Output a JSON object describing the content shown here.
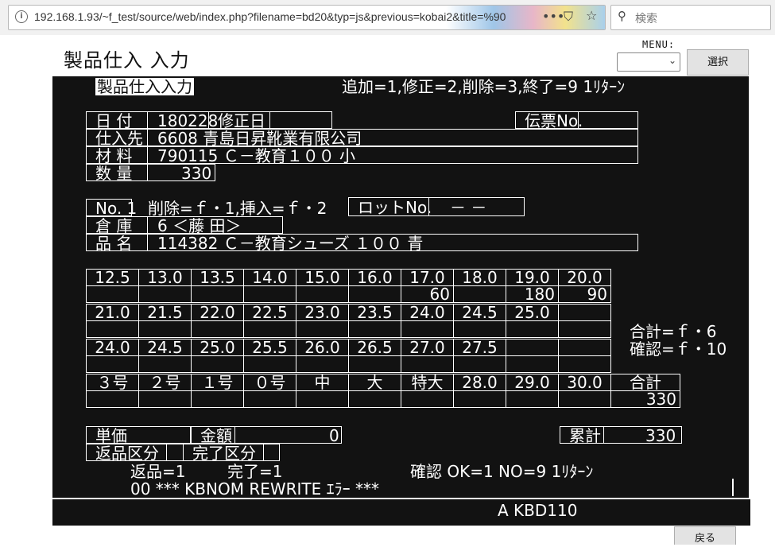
{
  "browser": {
    "url": "192.168.1.93/~f_test/source/web/index.php?filename=bd20&typ=js&previous=kobai2&title=%90",
    "search_placeholder": "検索"
  },
  "page": {
    "title": "製品仕入 入力",
    "menu_label": "MENU:",
    "menu_value": "",
    "select_button": "選択",
    "back_button": "戻る"
  },
  "screen": {
    "title": "製品仕入入力",
    "header_hint": "追加=1,修正=2,削除=3,終了=9  1ﾘﾀｰﾝ",
    "date_label": "日  付",
    "date": "180228",
    "modified_label": "修正日",
    "modified": "",
    "slip_label": "伝票No.",
    "slip": "",
    "supplier_label": "仕入先",
    "supplier": "6608 青島日昇靴業有限公司",
    "material_label": "材  料",
    "material": "790115 Ｃ－教育１００  小",
    "qty_label": "数  量",
    "qty": "330",
    "no_label": "No. 1",
    "row_hint": "削除=ｆ・1,挿入=ｆ・2",
    "lot_label": "ロットNo.",
    "lot": "－  －",
    "warehouse_label": "倉  庫",
    "warehouse": "6 ＜藤  田＞",
    "product_label": "品  名",
    "product": "114382 Ｃ－教育シューズ  １００    青",
    "size_blocks": [
      {
        "sizes": [
          "12.5",
          "13.0",
          "13.5",
          "14.0",
          "15.0",
          "16.0",
          "17.0",
          "18.0",
          "19.0",
          "20.0"
        ],
        "qtys": [
          "",
          "",
          "",
          "",
          "",
          "",
          "60",
          "",
          "180",
          "90"
        ]
      },
      {
        "sizes": [
          "21.0",
          "21.5",
          "22.0",
          "22.5",
          "23.0",
          "23.5",
          "24.0",
          "24.5",
          "25.0",
          ""
        ],
        "qtys": [
          "",
          "",
          "",
          "",
          "",
          "",
          "",
          "",
          "",
          ""
        ]
      },
      {
        "sizes": [
          "24.0",
          "24.5",
          "25.0",
          "25.5",
          "26.0",
          "26.5",
          "27.0",
          "27.5",
          "",
          ""
        ],
        "qtys": [
          "",
          "",
          "",
          "",
          "",
          "",
          "",
          "",
          "",
          ""
        ]
      },
      {
        "sizes": [
          "３号",
          "２号",
          "１号",
          "０号",
          "中",
          "大",
          "特大",
          "28.0",
          "29.0",
          "30.0",
          "合計"
        ],
        "qtys": [
          "",
          "",
          "",
          "",
          "",
          "",
          "",
          "",
          "",
          "",
          "330"
        ]
      }
    ],
    "total_hint": "合計=ｆ・6",
    "confirm_hint": "確認=ｆ・10",
    "unit_price_label": "単価",
    "unit_price": "",
    "amount_label": "金額",
    "amount": "0",
    "cumulative_label": "累計",
    "cumulative": "330",
    "return_label": "返品区分",
    "return_value": "",
    "complete_label": "完了区分",
    "complete_value": "",
    "return_hint": "返品=1",
    "complete_hint": "完了=1",
    "confirm_prompt": "確認  OK=1 NO=9  1ﾘﾀｰﾝ",
    "error_message": "00   ***  KBNOM REWRITE ｴﾗｰ  ***"
  },
  "status": {
    "text": "A    KBD110"
  }
}
